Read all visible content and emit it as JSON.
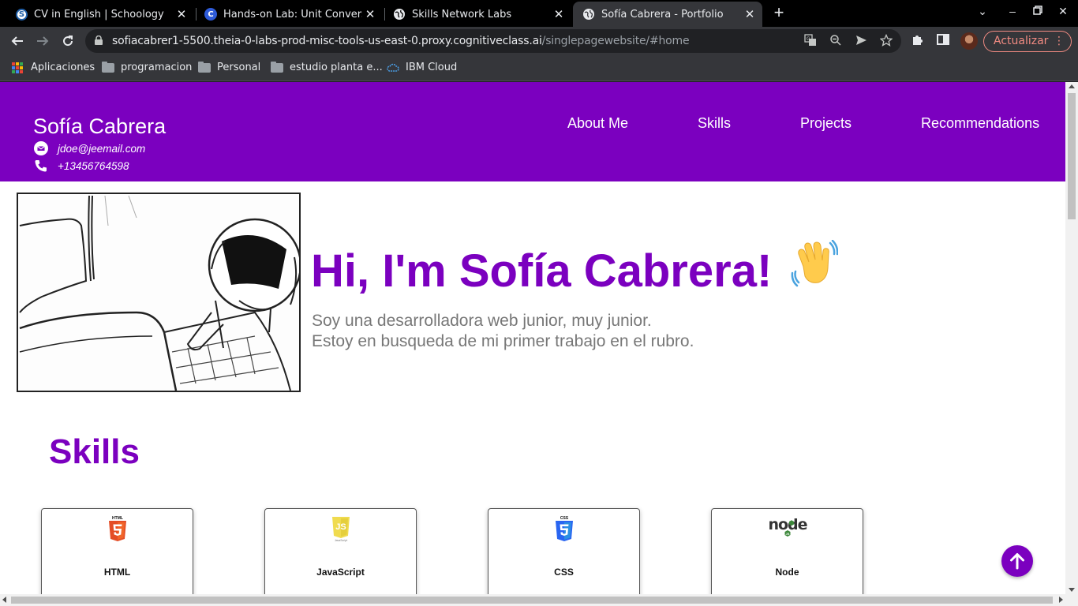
{
  "browser": {
    "tabs": [
      {
        "title": "CV in English | Schoology",
        "favicon": "S"
      },
      {
        "title": "Hands-on Lab: Unit Conversion",
        "favicon": "C"
      },
      {
        "title": "Skills Network Labs",
        "favicon": "globe"
      },
      {
        "title": "Sofía Cabrera - Portfolio",
        "favicon": "globe",
        "active": true
      }
    ],
    "url_host": "sofiacabrer1-5500.theia-0-labs-prod-misc-tools-us-east-0.proxy.cognitiveclass.ai",
    "url_path": "/singlepagewebsite/#home",
    "update_label": "Actualizar",
    "bookmarks": [
      "Aplicaciones",
      "programacion",
      "Personal",
      "estudio planta e...",
      "IBM Cloud"
    ]
  },
  "site": {
    "name": "Sofía Cabrera",
    "email": "jdoe@jeemail.com",
    "phone": "+13456764598",
    "nav": [
      "About Me",
      "Skills",
      "Projects",
      "Recommendations"
    ]
  },
  "hero": {
    "title": "Hi, I'm Sofía Cabrera!",
    "subtitle_line1": "Soy una desarrolladora web junior, muy junior.",
    "subtitle_line2": "Estoy en busqueda de mi primer trabajo en el rubro."
  },
  "skills": {
    "heading": "Skills",
    "items": [
      "HTML",
      "JavaScript",
      "CSS",
      "Node"
    ]
  },
  "colors": {
    "brand": "#7b00bf",
    "html": "#e44d26",
    "javascript": "#f0db4f",
    "css": "#2965f1",
    "node": "#3c873a"
  },
  "icons": [
    "back-arrow-icon",
    "forward-arrow-icon",
    "reload-icon",
    "lock-icon",
    "translate-icon",
    "zoom-icon",
    "send-icon",
    "star-icon",
    "extensions-icon",
    "reading-mode-icon",
    "email-icon",
    "phone-icon",
    "wave-hand-icon",
    "arrow-up-icon"
  ]
}
